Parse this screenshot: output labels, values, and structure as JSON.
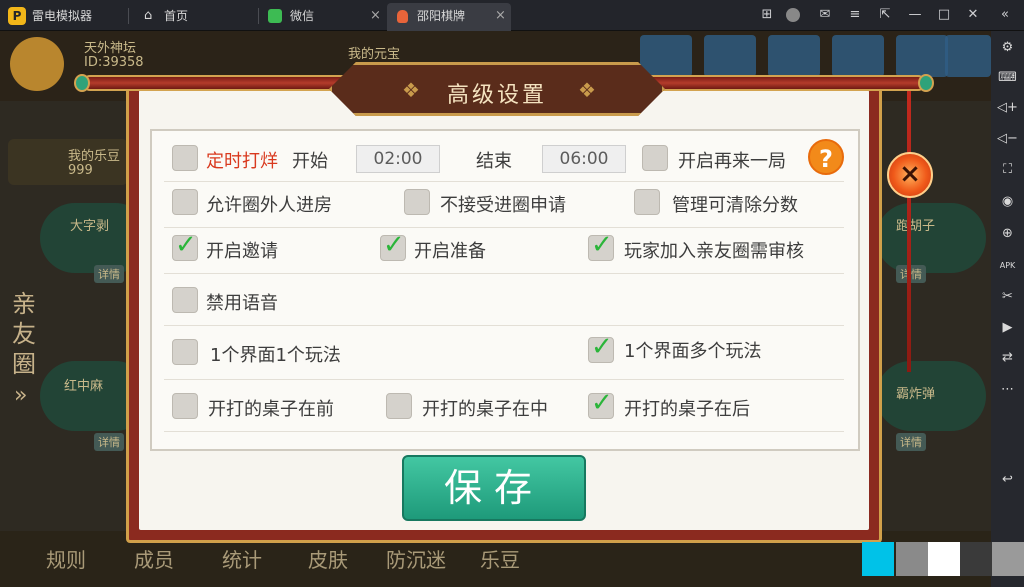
{
  "titlebar": {
    "app_name": "雷电模拟器",
    "tabs": [
      {
        "label": "首页",
        "icon": "home-icon"
      },
      {
        "label": "微信",
        "icon": "wechat-icon"
      },
      {
        "label": "邵阳棋牌",
        "icon": "game-icon"
      }
    ],
    "close_glyph": "×"
  },
  "game_background": {
    "player_name": "天外神坛",
    "player_id": "ID:39358",
    "my_yuanbao": "我的元宝",
    "my_ledou": "我的乐豆",
    "ledou_value": "999",
    "side_label": "亲友圈",
    "side_arrow": "»",
    "table_labels": [
      "大字剥",
      "红中麻",
      "跑胡子",
      "霸炸弹"
    ],
    "detail_label": "详情",
    "bottom_nav": [
      "规则",
      "成员",
      "统计",
      "皮肤",
      "防沉迷",
      "乐豆"
    ]
  },
  "dialog": {
    "title": "高级设置",
    "row1": {
      "timed_label": "定时打烊",
      "start_label": "开始",
      "start_time": "02:00",
      "end_label": "结束",
      "end_time": "06:00",
      "restart_label": "开启再来一局"
    },
    "help_glyph": "?",
    "options": [
      {
        "label": "允许圈外人进房",
        "checked": false
      },
      {
        "label": "不接受进圈申请",
        "checked": false
      },
      {
        "label": "管理可清除分数",
        "checked": false
      },
      {
        "label": "开启邀请",
        "checked": true
      },
      {
        "label": "开启准备",
        "checked": true
      },
      {
        "label": "玩家加入亲友圈需审核",
        "checked": true
      },
      {
        "label": "禁用语音",
        "checked": false
      },
      {
        "label": "1个界面1个玩法",
        "checked": false
      },
      {
        "label": "1个界面多个玩法",
        "checked": true
      },
      {
        "label": "开打的桌子在前",
        "checked": false
      },
      {
        "label": "开打的桌子在中",
        "checked": false
      },
      {
        "label": "开打的桌子在后",
        "checked": true
      }
    ],
    "save_label": "保存",
    "close_glyph": "×",
    "check_glyph": "✓"
  },
  "colors": {
    "accent_red": "#d9391e",
    "check_green": "#2bb53a",
    "save_teal": "#1e9a7a",
    "frame_red": "#8b2a1f"
  }
}
